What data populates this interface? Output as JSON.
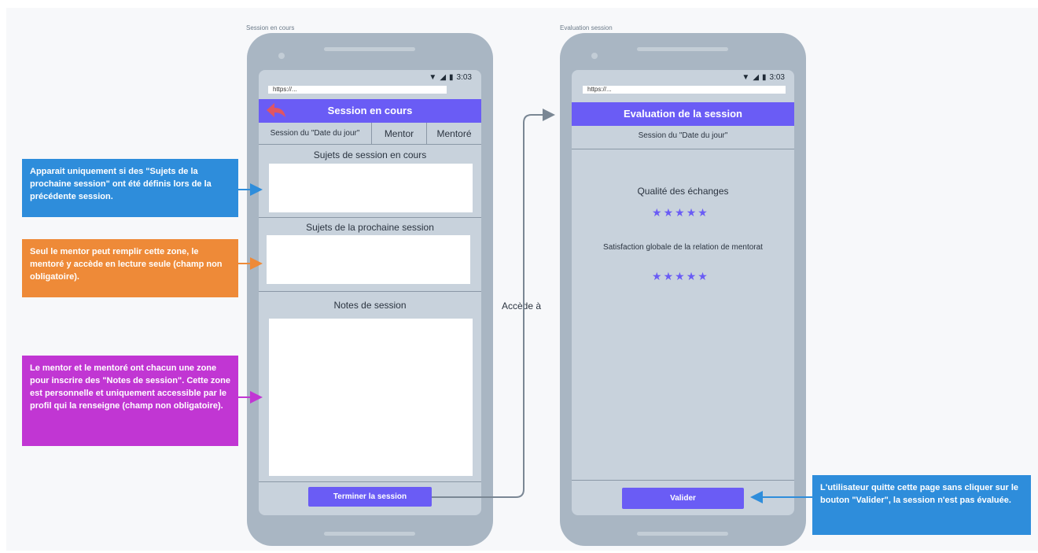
{
  "frames": {
    "left_label": "Session en cours",
    "right_label": "Evaluation session"
  },
  "status_bar": {
    "time": "3:03",
    "url": "https://..."
  },
  "session_screen": {
    "title": "Session en cours",
    "tabs": [
      "Session du \"Date du jour\"",
      "Mentor",
      "Mentoré"
    ],
    "section_current_topics": "Sujets de session en cours",
    "section_next_topics": "Sujets de la prochaine session",
    "section_notes": "Notes de session",
    "end_button": "Terminer la session"
  },
  "evaluation_screen": {
    "title": "Evaluation de la session",
    "subtitle": "Session du \"Date du jour\"",
    "quality_label": "Qualité des échanges",
    "quality_rating": 5,
    "satisfaction_label": "Satisfaction globale de la relation de mentorat",
    "satisfaction_rating": 5,
    "validate_button": "Valider"
  },
  "flow": {
    "label": "Accède à"
  },
  "annotations": {
    "blue_note": "Apparait uniquement si des \"Sujets de la prochaine session\" ont été définis lors de la précédente session.",
    "orange_note": "Seul le mentor peut remplir cette zone, le mentoré y accède en lecture seule (champ non obligatoire).",
    "purple_note": "Le mentor et le mentoré ont chacun une zone pour inscrire des \"Notes de session\". Cette zone est personnelle et uniquement accessible par le profil qui la renseigne (champ non obligatoire).",
    "right_note": "L'utilisateur quitte cette page sans cliquer sur le bouton \"Valider\", la session n'est pas évaluée."
  },
  "colors": {
    "accent": "#6a5cf5",
    "blue_note": "#2e8ddb",
    "orange_note": "#ee8a38",
    "purple_note": "#c136d3",
    "connector": "#7a8794"
  }
}
